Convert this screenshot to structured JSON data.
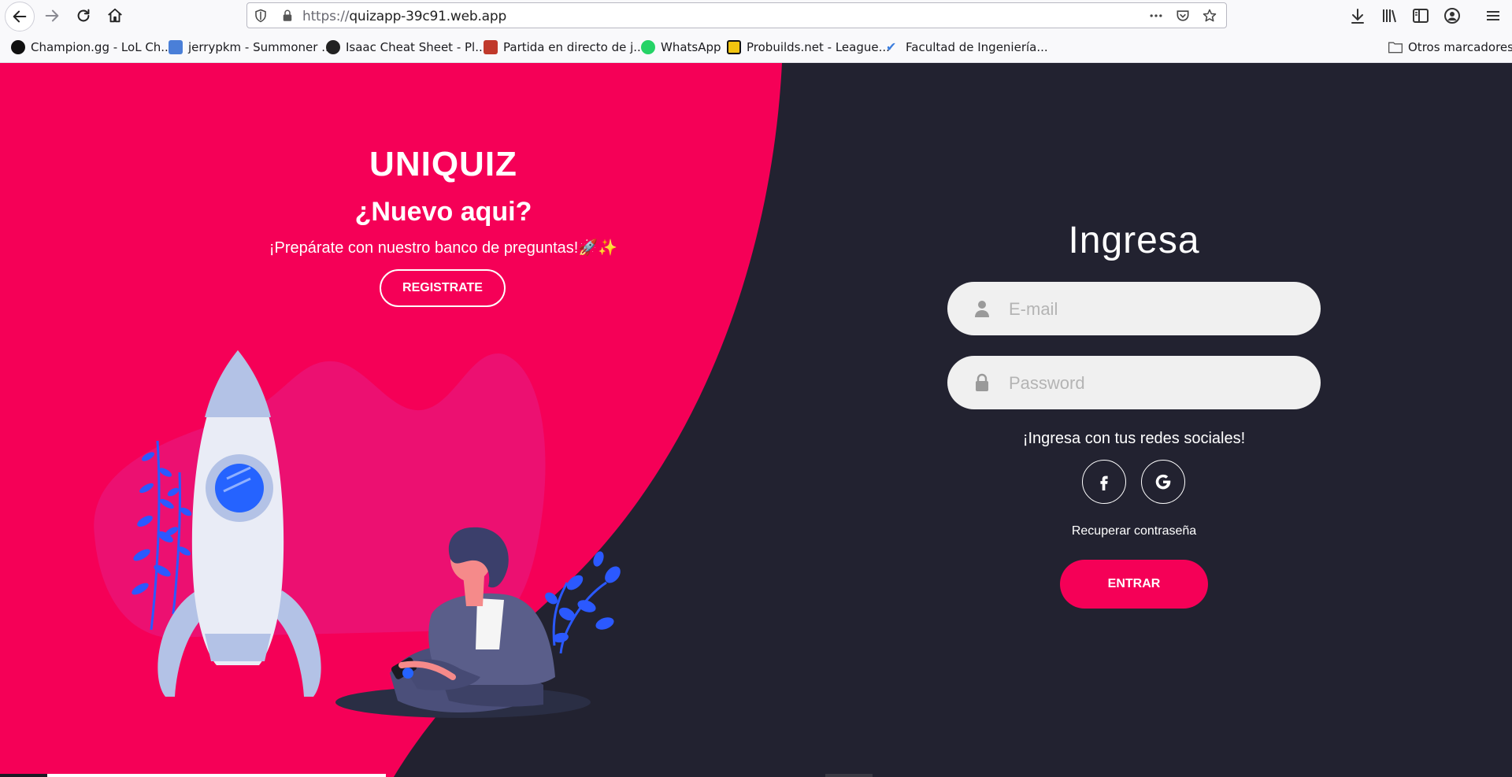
{
  "browser": {
    "url_protocol": "https://",
    "url_host": "quizapp-39c91.web.app",
    "bookmarks": [
      {
        "label": "Champion.gg - LoL Ch...",
        "color": "#111111"
      },
      {
        "label": "jerrypkm - Summoner ...",
        "color": "#4a7fd8"
      },
      {
        "label": "Isaac Cheat Sheet - Pl...",
        "color": "#222222"
      },
      {
        "label": "Partida en directo de j...",
        "color": "#c0392b"
      },
      {
        "label": "WhatsApp",
        "color": "#25d366"
      },
      {
        "label": "Probuilds.net - League...",
        "color": "#f1c40f"
      },
      {
        "label": "Facultad de Ingeniería...",
        "color": "#3b7ddd"
      }
    ],
    "other_bookmarks": "Otros marcadores"
  },
  "welcome": {
    "brand": "UNIQUIZ",
    "heading": "¿Nuevo aqui?",
    "tagline": "¡Prepárate con nuestro banco de preguntas!🚀✨",
    "register_label": "REGISTRATE"
  },
  "login": {
    "heading": "Ingresa",
    "email_placeholder": "E-mail",
    "password_placeholder": "Password",
    "social_label": "¡Ingresa con tus redes sociales!",
    "recover_label": "Recuperar contraseña",
    "enter_label": "ENTRAR"
  },
  "colors": {
    "accent": "#f50057",
    "dark_bg": "#222230",
    "input_bg": "#f0f0f0"
  },
  "icons": {
    "email": "user-icon",
    "password": "lock-icon",
    "social": [
      "facebook-icon",
      "google-icon"
    ]
  }
}
